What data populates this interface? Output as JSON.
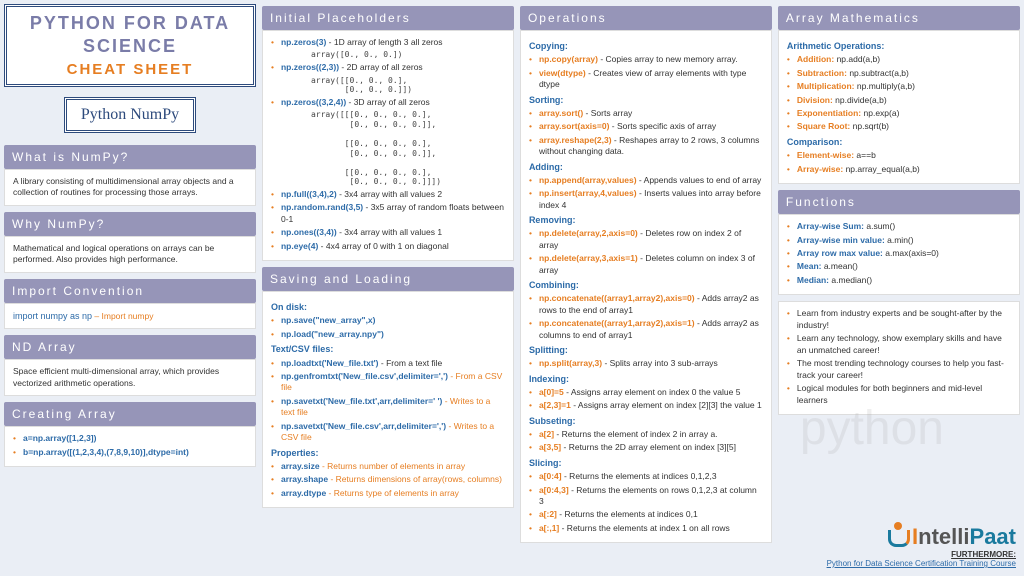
{
  "header": {
    "title1": "PYTHON FOR DATA",
    "title2": "SCIENCE",
    "cheat": "CHEAT SHEET",
    "badge": "Python NumPy"
  },
  "whatIs": {
    "h": "What is NumPy?",
    "body": "A library consisting of multidimensional array objects and a collection of routines for processing those arrays."
  },
  "why": {
    "h": "Why NumPy?",
    "body": "Mathematical and logical operations on arrays can be performed. Also provides high performance."
  },
  "import": {
    "h": "Import Convention",
    "code": "import numpy as np",
    "comment": " – Import numpy"
  },
  "ndarray": {
    "h": "ND Array",
    "body": "Space efficient multi-dimensional array, which provides vectorized arithmetic operations."
  },
  "creating": {
    "h": "Creating Array",
    "items": [
      {
        "c": "a=np.array([1,2,3])",
        "d": ""
      },
      {
        "c": "b=np.array([(1,2,3,4),(7,8,9,10)],dtype=int)",
        "d": ""
      }
    ]
  },
  "placeholders": {
    "h": "Initial Placeholders",
    "items": [
      {
        "c": "np.zeros(3)",
        "d": " - 1D array of length 3 all zeros",
        "out": "array([0., 0., 0.])"
      },
      {
        "c": "np.zeros((2,3))",
        "d": " - 2D array of all zeros",
        "out": "array([[0., 0., 0.],\n       [0., 0., 0.]])"
      },
      {
        "c": "np.zeros((3,2,4))",
        "d": " - 3D array of all zeros",
        "out": "array([[[0., 0., 0., 0.],\n        [0., 0., 0., 0.]],\n\n       [[0., 0., 0., 0.],\n        [0., 0., 0., 0.]],\n\n       [[0., 0., 0., 0.],\n        [0., 0., 0., 0.]]])"
      },
      {
        "c": "np.full((3,4),2)",
        "d": " - 3x4 array with all values 2"
      },
      {
        "c": "np.random.rand(3,5)",
        "d": " - 3x5 array of random floats between 0-1"
      },
      {
        "c": "np.ones((3,4))",
        "d": " - 3x4 array with all values 1"
      },
      {
        "c": "np.eye(4)",
        "d": " - 4x4 array of 0 with 1 on diagonal"
      }
    ]
  },
  "saving": {
    "h": "Saving and Loading",
    "disk_h": "On disk:",
    "disk": [
      {
        "c": "np.save(\"new_array\",x)"
      },
      {
        "c": "np.load(\"new_array.npy\")"
      }
    ],
    "csv_h": "Text/CSV files:",
    "csv": [
      {
        "c": "np.loadtxt('New_file.txt')",
        "d": " - From a text file"
      },
      {
        "c": "np.genfromtxt('New_file.csv',delimiter=',')",
        "d": " - From a CSV file",
        "orange": true
      },
      {
        "c": "np.savetxt('New_file.txt',arr,delimiter=' ')",
        "d": " - Writes to a text file",
        "orange": true
      },
      {
        "c": "np.savetxt('New_file.csv',arr,delimiter=',')",
        "d": " - Writes to a CSV file",
        "orange": true
      }
    ],
    "props_h": "Properties:",
    "props": [
      {
        "c": "array.size",
        "d": " - Returns number of elements in array",
        "orange": true
      },
      {
        "c": "array.shape",
        "d": " - Returns dimensions of array(rows, columns)",
        "orange": true
      },
      {
        "c": "array.dtype",
        "d": " - Returns type of elements in array",
        "orange": true
      }
    ]
  },
  "operations": {
    "h": "Operations",
    "groups": [
      {
        "h": "Copying:",
        "items": [
          {
            "c": "np.copy(array)",
            "d": " - Copies array to new memory array."
          },
          {
            "c": "view(dtype)",
            "d": " - Creates view of array elements with type dtype"
          }
        ]
      },
      {
        "h": "Sorting:",
        "items": [
          {
            "c": "array.sort()",
            "d": " - Sorts array"
          },
          {
            "c": "array.sort(axis=0)",
            "d": " - Sorts specific axis of array"
          },
          {
            "c": "array.reshape(2,3)",
            "d": " - Reshapes array to 2 rows, 3 columns without changing data."
          }
        ]
      },
      {
        "h": "Adding:",
        "items": [
          {
            "c": "np.append(array,values)",
            "d": " - Appends values to end of array"
          },
          {
            "c": "np.insert(array,4,values)",
            "d": " - Inserts values into array before index 4"
          }
        ]
      },
      {
        "h": "Removing:",
        "items": [
          {
            "c": "np.delete(array,2,axis=0)",
            "d": " - Deletes row on index 2 of array"
          },
          {
            "c": "np.delete(array,3,axis=1)",
            "d": " - Deletes column on index 3 of array"
          }
        ]
      },
      {
        "h": "Combining:",
        "items": [
          {
            "c": "np.concatenate((array1,array2),axis=0)",
            "d": " - Adds array2 as rows to the end of array1"
          },
          {
            "c": "np.concatenate((array1,array2),axis=1)",
            "d": " - Adds array2 as columns to end of array1"
          }
        ]
      },
      {
        "h": "Splitting:",
        "items": [
          {
            "c": "np.split(array,3)",
            "d": " - Splits array into 3 sub-arrays"
          }
        ]
      },
      {
        "h": "Indexing:",
        "items": [
          {
            "c": "a[0]=5",
            "d": " - Assigns array element on index 0 the value 5"
          },
          {
            "c": "a[2,3]=1",
            "d": " - Assigns array element on index [2][3] the value 1"
          }
        ]
      },
      {
        "h": "Subseting:",
        "items": [
          {
            "c": "a[2]",
            "d": " - Returns the element of index 2 in array a."
          },
          {
            "c": "a[3,5]",
            "d": " - Returns the 2D array element on index [3][5]"
          }
        ]
      },
      {
        "h": "Slicing:",
        "items": [
          {
            "c": "a[0:4]",
            "d": " - Returns the elements at indices 0,1,2,3"
          },
          {
            "c": "a[0:4,3]",
            "d": " - Returns the elements on rows 0,1,2,3 at column 3"
          },
          {
            "c": "a[:2]",
            "d": " - Returns the elements at indices 0,1"
          },
          {
            "c": "a[:,1]",
            "d": " - Returns the elements at index 1 on all rows"
          }
        ]
      }
    ]
  },
  "math": {
    "h": "Array Mathematics",
    "arith_h": "Arithmetic Operations:",
    "arith": [
      {
        "c": "Addition:",
        "d": " np.add(a,b)"
      },
      {
        "c": "Subtraction:",
        "d": " np.subtract(a,b)"
      },
      {
        "c": "Multiplication:",
        "d": " np.multiply(a,b)"
      },
      {
        "c": "Division:",
        "d": " np.divide(a,b)"
      },
      {
        "c": "Exponentiation:",
        "d": " np.exp(a)"
      },
      {
        "c": "Square Root:",
        "d": " np.sqrt(b)"
      }
    ],
    "comp_h": "Comparison:",
    "comp": [
      {
        "c": "Element-wise:",
        "d": " a==b"
      },
      {
        "c": "Array-wise:",
        "d": " np.array_equal(a,b)"
      }
    ]
  },
  "functions": {
    "h": "Functions",
    "items": [
      {
        "c": "Array-wise Sum:",
        "d": " a.sum()"
      },
      {
        "c": "Array-wise min value:",
        "d": " a.min()"
      },
      {
        "c": "Array row max value:",
        "d": "  a.max(axis=0)"
      },
      {
        "c": "Mean:",
        "d": " a.mean()"
      },
      {
        "c": "Median:",
        "d": " a.median()"
      }
    ]
  },
  "promo": [
    "Learn from industry experts and be sought-after by the industry!",
    "Learn any technology, show exemplary skills and have an unmatched career!",
    "The most trending technology courses to help you fast-track your career!",
    "Logical modules for both beginners and mid-level learners"
  ],
  "footer": {
    "furthermore": "FURTHERMORE:",
    "link": "Python for Data Science Certification Training Course"
  }
}
